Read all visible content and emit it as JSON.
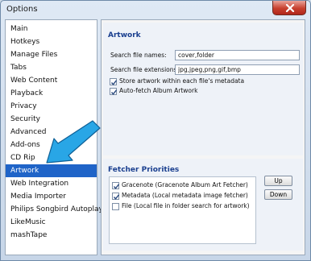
{
  "window": {
    "title": "Options"
  },
  "sidebar": {
    "items": [
      {
        "label": "Main"
      },
      {
        "label": "Hotkeys"
      },
      {
        "label": "Manage Files"
      },
      {
        "label": "Tabs"
      },
      {
        "label": "Web Content"
      },
      {
        "label": "Playback"
      },
      {
        "label": "Privacy"
      },
      {
        "label": "Security"
      },
      {
        "label": "Advanced"
      },
      {
        "label": "Add-ons"
      },
      {
        "label": "CD Rip"
      },
      {
        "label": "Artwork"
      },
      {
        "label": "Web Integration"
      },
      {
        "label": "Media Importer"
      },
      {
        "label": "Philips Songbird Autoplay"
      },
      {
        "label": "LikeMusic"
      },
      {
        "label": "mashTape"
      }
    ],
    "selected": "Artwork"
  },
  "artwork": {
    "title": "Artwork",
    "file_names_label": "Search file names:",
    "file_names_value": "cover,folder",
    "extensions_label": "Search file extensions:",
    "extensions_value": "jpg,jpeg,png,gif,bmp",
    "store_label": "Store artwork within each file's metadata",
    "store_checked": true,
    "autofetch_label": "Auto-fetch Album Artwork",
    "autofetch_checked": true
  },
  "fetcher": {
    "title": "Fetcher Priorities",
    "items": [
      {
        "label": "Gracenote (Gracenote Album Art Fetcher)",
        "checked": true
      },
      {
        "label": "Metadata (Local metadata image fetcher)",
        "checked": true
      },
      {
        "label": "File (Local file in folder search for artwork)",
        "checked": false
      }
    ],
    "up_label": "Up",
    "down_label": "Down"
  },
  "colors": {
    "selection": "#1f64c8",
    "section_title": "#1a3f8f",
    "arrow": "#29a6e6",
    "close_button": "#c7402e"
  }
}
